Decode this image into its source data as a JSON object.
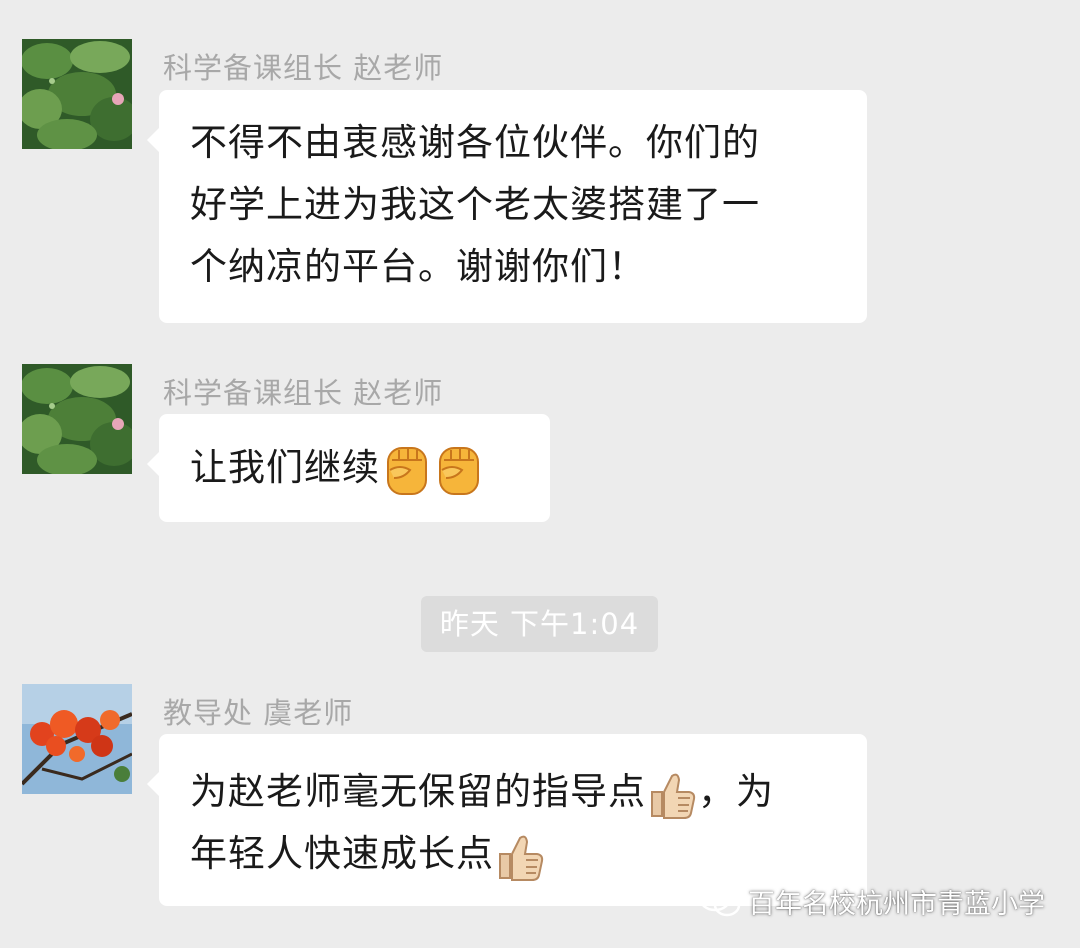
{
  "messages": [
    {
      "sender": "科学备课组长 赵老师",
      "lines": [
        "不得不由衷感谢各位伙伴。你们的",
        "好学上进为我这个老太婆搭建了一",
        "个纳凉的平台。谢谢你们！"
      ]
    },
    {
      "sender": "科学备课组长 赵老师",
      "text": "让我们继续",
      "emojis": [
        "raised-fist-emoji",
        "raised-fist-emoji"
      ]
    },
    {
      "sender": "教导处 虞老师",
      "line1": "为赵老师毫无保留的指导点",
      "line1_after": "，为",
      "line2": "年轻人快速成长点",
      "emojis": [
        "thumbs-up-emoji",
        "thumbs-up-emoji"
      ]
    }
  ],
  "timestamp": "昨天 下午1:04",
  "watermark": {
    "icon": "wechat-icon",
    "text": "百年名校杭州市青蓝小学"
  },
  "colors": {
    "background": "#ececec",
    "bubble": "#ffffff",
    "sender_name": "#a8a8a8",
    "timestamp_pill": "#dcdcdc"
  }
}
